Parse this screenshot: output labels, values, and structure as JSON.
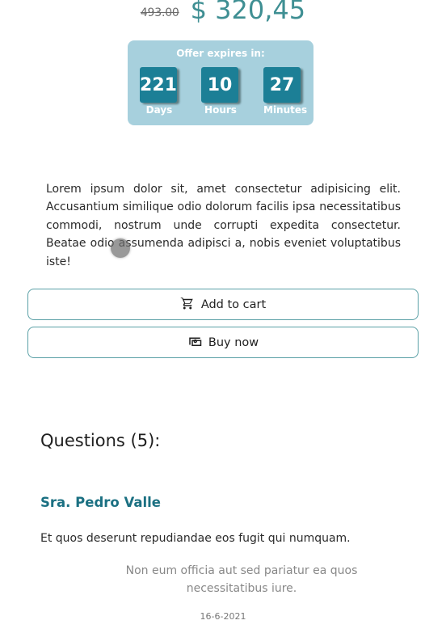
{
  "pricing": {
    "old_price": "493.00",
    "new_price": "$ 320,45"
  },
  "offer": {
    "title": "Offer expires in:",
    "countdown": [
      {
        "value": "221",
        "label": "Days"
      },
      {
        "value": "10",
        "label": "Hours"
      },
      {
        "value": "27",
        "label": "Minutes"
      }
    ]
  },
  "description": "Lorem ipsum dolor sit, amet consectetur adipisicing elit. Accusantium similique odio dolorum facilis ipsa necessitatibus commodi, nostrum unde corrupti expedita consectetur. Beatae odio assumenda adipisci a, nobis eveniet voluptatibus iste!",
  "actions": {
    "add_to_cart": {
      "label": "Add to cart",
      "icon": "shopping-cart-icon"
    },
    "buy_now": {
      "label": "Buy now",
      "icon": "money-icon"
    }
  },
  "questions": {
    "title": "Questions (5):",
    "items": [
      {
        "author": "Sra. Pedro Valle",
        "question": "Et quos deserunt repudiandae eos fugit qui numquam.",
        "answer": "Non eum officia aut sed pariatur ea quos necessitatibus iure.",
        "date": "16-6-2021"
      }
    ]
  },
  "colors": {
    "accent": "#3f8f93",
    "countdown_bg": "#1c7f96",
    "offer_box_bg": "#a7d0dd",
    "author": "#1b7082"
  }
}
